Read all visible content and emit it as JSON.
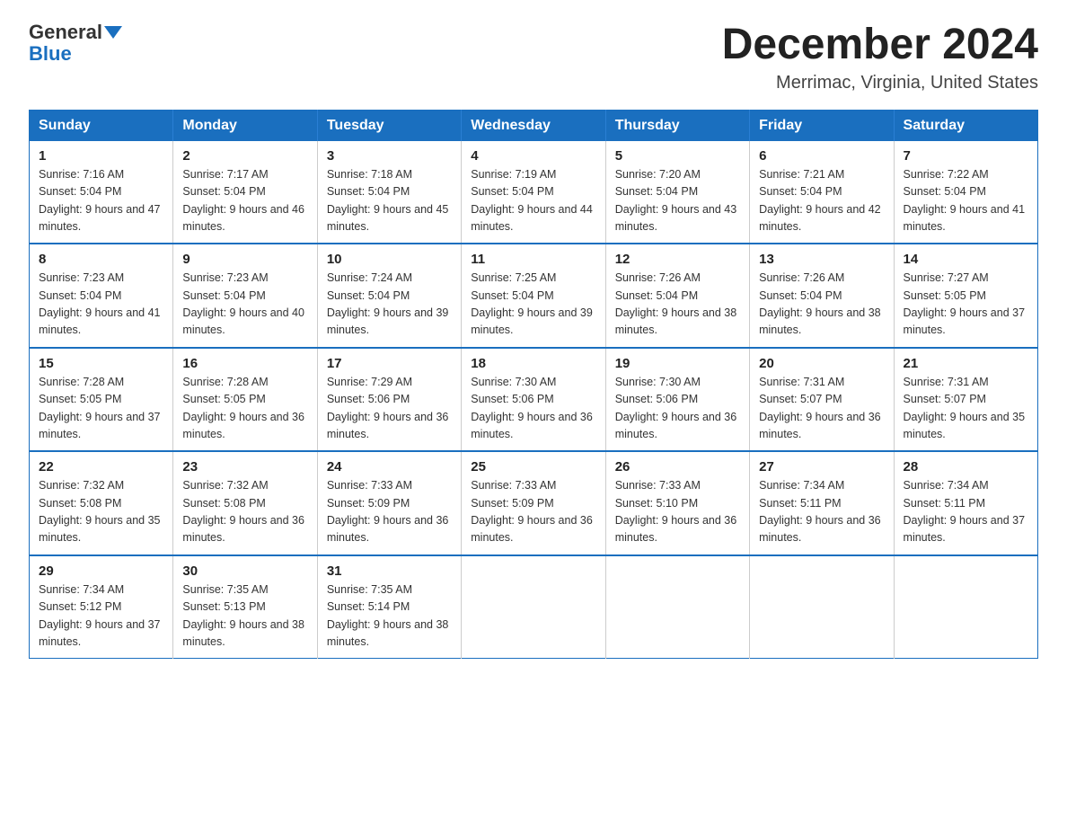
{
  "header": {
    "logo_text_normal": "General",
    "logo_text_blue": "Blue",
    "main_title": "December 2024",
    "subtitle": "Merrimac, Virginia, United States"
  },
  "days_of_week": [
    "Sunday",
    "Monday",
    "Tuesday",
    "Wednesday",
    "Thursday",
    "Friday",
    "Saturday"
  ],
  "weeks": [
    [
      {
        "day": "1",
        "sunrise": "7:16 AM",
        "sunset": "5:04 PM",
        "daylight": "9 hours and 47 minutes."
      },
      {
        "day": "2",
        "sunrise": "7:17 AM",
        "sunset": "5:04 PM",
        "daylight": "9 hours and 46 minutes."
      },
      {
        "day": "3",
        "sunrise": "7:18 AM",
        "sunset": "5:04 PM",
        "daylight": "9 hours and 45 minutes."
      },
      {
        "day": "4",
        "sunrise": "7:19 AM",
        "sunset": "5:04 PM",
        "daylight": "9 hours and 44 minutes."
      },
      {
        "day": "5",
        "sunrise": "7:20 AM",
        "sunset": "5:04 PM",
        "daylight": "9 hours and 43 minutes."
      },
      {
        "day": "6",
        "sunrise": "7:21 AM",
        "sunset": "5:04 PM",
        "daylight": "9 hours and 42 minutes."
      },
      {
        "day": "7",
        "sunrise": "7:22 AM",
        "sunset": "5:04 PM",
        "daylight": "9 hours and 41 minutes."
      }
    ],
    [
      {
        "day": "8",
        "sunrise": "7:23 AM",
        "sunset": "5:04 PM",
        "daylight": "9 hours and 41 minutes."
      },
      {
        "day": "9",
        "sunrise": "7:23 AM",
        "sunset": "5:04 PM",
        "daylight": "9 hours and 40 minutes."
      },
      {
        "day": "10",
        "sunrise": "7:24 AM",
        "sunset": "5:04 PM",
        "daylight": "9 hours and 39 minutes."
      },
      {
        "day": "11",
        "sunrise": "7:25 AM",
        "sunset": "5:04 PM",
        "daylight": "9 hours and 39 minutes."
      },
      {
        "day": "12",
        "sunrise": "7:26 AM",
        "sunset": "5:04 PM",
        "daylight": "9 hours and 38 minutes."
      },
      {
        "day": "13",
        "sunrise": "7:26 AM",
        "sunset": "5:04 PM",
        "daylight": "9 hours and 38 minutes."
      },
      {
        "day": "14",
        "sunrise": "7:27 AM",
        "sunset": "5:05 PM",
        "daylight": "9 hours and 37 minutes."
      }
    ],
    [
      {
        "day": "15",
        "sunrise": "7:28 AM",
        "sunset": "5:05 PM",
        "daylight": "9 hours and 37 minutes."
      },
      {
        "day": "16",
        "sunrise": "7:28 AM",
        "sunset": "5:05 PM",
        "daylight": "9 hours and 36 minutes."
      },
      {
        "day": "17",
        "sunrise": "7:29 AM",
        "sunset": "5:06 PM",
        "daylight": "9 hours and 36 minutes."
      },
      {
        "day": "18",
        "sunrise": "7:30 AM",
        "sunset": "5:06 PM",
        "daylight": "9 hours and 36 minutes."
      },
      {
        "day": "19",
        "sunrise": "7:30 AM",
        "sunset": "5:06 PM",
        "daylight": "9 hours and 36 minutes."
      },
      {
        "day": "20",
        "sunrise": "7:31 AM",
        "sunset": "5:07 PM",
        "daylight": "9 hours and 36 minutes."
      },
      {
        "day": "21",
        "sunrise": "7:31 AM",
        "sunset": "5:07 PM",
        "daylight": "9 hours and 35 minutes."
      }
    ],
    [
      {
        "day": "22",
        "sunrise": "7:32 AM",
        "sunset": "5:08 PM",
        "daylight": "9 hours and 35 minutes."
      },
      {
        "day": "23",
        "sunrise": "7:32 AM",
        "sunset": "5:08 PM",
        "daylight": "9 hours and 36 minutes."
      },
      {
        "day": "24",
        "sunrise": "7:33 AM",
        "sunset": "5:09 PM",
        "daylight": "9 hours and 36 minutes."
      },
      {
        "day": "25",
        "sunrise": "7:33 AM",
        "sunset": "5:09 PM",
        "daylight": "9 hours and 36 minutes."
      },
      {
        "day": "26",
        "sunrise": "7:33 AM",
        "sunset": "5:10 PM",
        "daylight": "9 hours and 36 minutes."
      },
      {
        "day": "27",
        "sunrise": "7:34 AM",
        "sunset": "5:11 PM",
        "daylight": "9 hours and 36 minutes."
      },
      {
        "day": "28",
        "sunrise": "7:34 AM",
        "sunset": "5:11 PM",
        "daylight": "9 hours and 37 minutes."
      }
    ],
    [
      {
        "day": "29",
        "sunrise": "7:34 AM",
        "sunset": "5:12 PM",
        "daylight": "9 hours and 37 minutes."
      },
      {
        "day": "30",
        "sunrise": "7:35 AM",
        "sunset": "5:13 PM",
        "daylight": "9 hours and 38 minutes."
      },
      {
        "day": "31",
        "sunrise": "7:35 AM",
        "sunset": "5:14 PM",
        "daylight": "9 hours and 38 minutes."
      },
      null,
      null,
      null,
      null
    ]
  ]
}
